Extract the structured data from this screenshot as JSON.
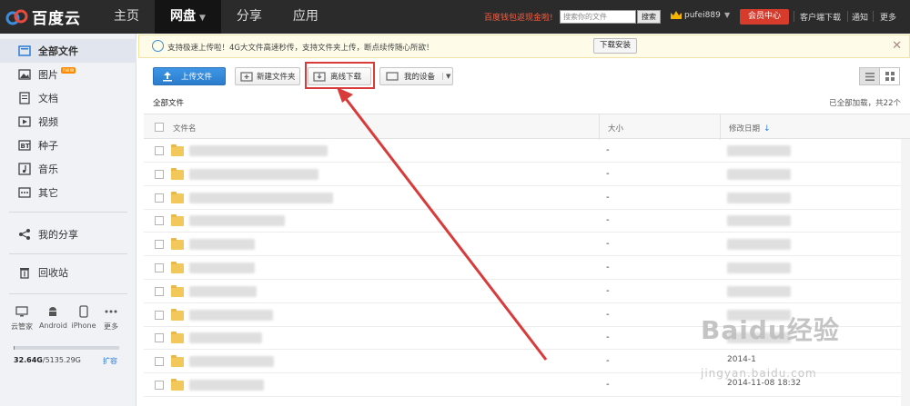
{
  "brand": {
    "name": "百度云"
  },
  "nav": [
    {
      "label": "主页"
    },
    {
      "label": "网盘"
    },
    {
      "label": "分享"
    },
    {
      "label": "应用"
    }
  ],
  "topbar": {
    "promo": "百度钱包返现金啦!",
    "search_placeholder": "搜索你的文件",
    "search_button": "搜索",
    "username": "pufei889",
    "vip_button": "会员中心",
    "client_download": "客户端下载",
    "notify": "通知",
    "more": "更多"
  },
  "sidebar": {
    "items": [
      {
        "label": "全部文件",
        "icon": "files-icon"
      },
      {
        "label": "图片",
        "icon": "image-icon",
        "badge": "new"
      },
      {
        "label": "文档",
        "icon": "document-icon"
      },
      {
        "label": "视频",
        "icon": "video-icon"
      },
      {
        "label": "种子",
        "icon": "torrent-icon"
      },
      {
        "label": "音乐",
        "icon": "music-icon"
      },
      {
        "label": "其它",
        "icon": "other-icon"
      }
    ],
    "my_share": "我的分享",
    "recycle": "回收站",
    "devices": [
      {
        "label": "云管家"
      },
      {
        "label": "Android"
      },
      {
        "label": "iPhone"
      },
      {
        "label": "更多"
      }
    ],
    "quota_used": "32.64G",
    "quota_total": "/5135.29G",
    "quota_fraction": 0.006,
    "expand": "扩容"
  },
  "notice": {
    "text": "支持极速上传啦！4G大文件高速秒传，支持文件夹上传，断点续传随心所欲！",
    "button": "下载安装"
  },
  "toolbar": {
    "upload": "上传文件",
    "new_folder": "新建文件夹",
    "offline_download": "离线下载",
    "my_devices": "我的设备"
  },
  "list": {
    "breadcrumb": "全部文件",
    "loaded_status": "已全部加载，共22个",
    "col_name": "文件名",
    "col_size": "大小",
    "col_date": "修改日期",
    "rows": [
      {
        "size": "-",
        "date": ""
      },
      {
        "size": "-",
        "date": ""
      },
      {
        "size": "-",
        "date": ""
      },
      {
        "size": "-",
        "date": ""
      },
      {
        "size": "-",
        "date": ""
      },
      {
        "size": "-",
        "date": ""
      },
      {
        "size": "-",
        "date": ""
      },
      {
        "size": "-",
        "date": ""
      },
      {
        "size": "-",
        "date": ""
      },
      {
        "size": "-",
        "date": "2014-1"
      },
      {
        "size": "-",
        "date": "2014-11-08 18:32"
      }
    ]
  },
  "watermark": {
    "main": "Baidu经验",
    "sub": "jingyan.baidu.com"
  },
  "colors": {
    "accent": "#2c7bd6",
    "highlight": "#d93a3a",
    "topbar": "#2b2b2b"
  }
}
